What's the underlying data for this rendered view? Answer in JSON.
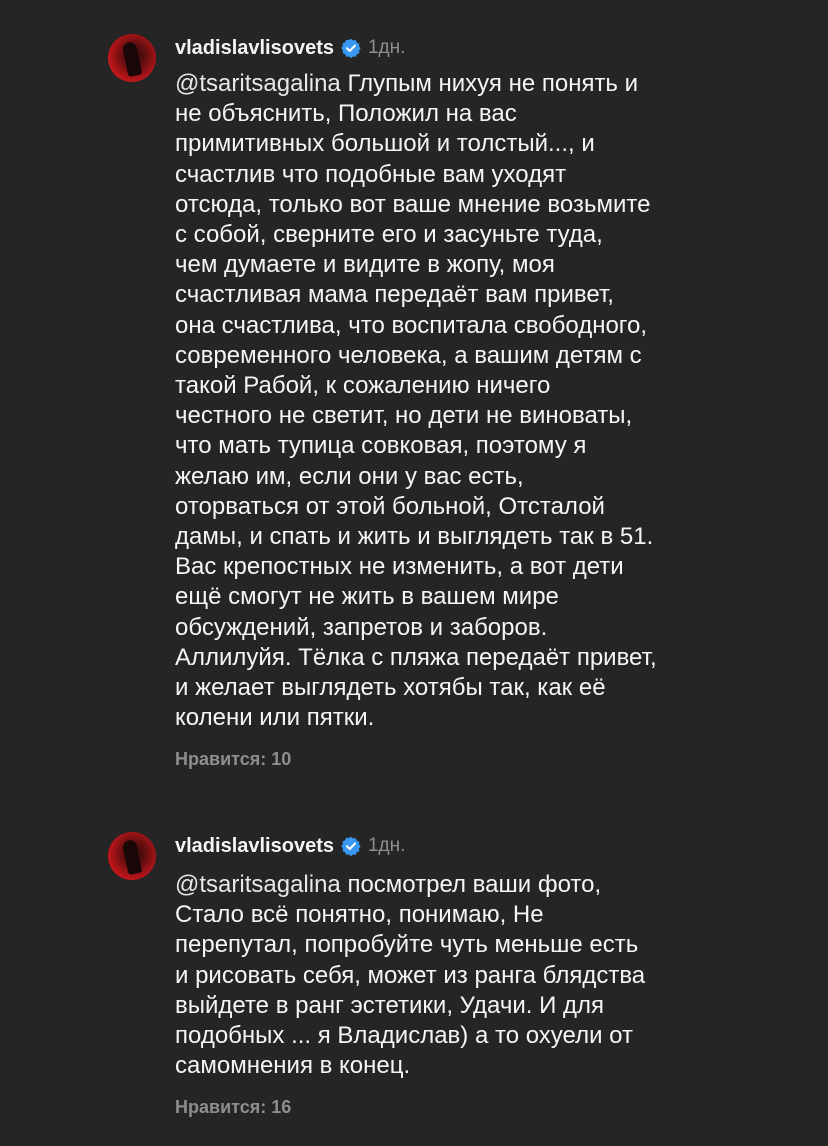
{
  "comments": [
    {
      "username": "vladislavlisovets",
      "time": "1дн.",
      "mention": "@tsaritsagalina",
      "text": "Глупым нихуя не понять и\nне объяснить,  Положил на вас\nпримитивных большой и толстый..., и\nсчастлив что подобные вам уходят\nотсюда, только вот ваше мнение возьмите\nс собой, сверните его и засуньте туда,\nчем думаете и видите в жопу,  моя\nсчастливая мама передаёт вам привет,\nона счастлива, что воспитала свободного,\nсовременного человека, а вашим детям с\nтакой Рабой, к сожалению ничего\nчестного не светит, но дети не виноваты,\nчто мать тупица совковая, поэтому я\nжелаю им, если они у вас есть,\nоторваться от этой больной, Отсталой\nдамы, и спать и жить и выглядеть так в 51.\nВас крепостных не изменить, а вот дети\nещё смогут не жить в вашем мире\nобсуждений, запретов и заборов.\nАллилуйя. Тёлка с пляжа передаёт привет,\nи желает выглядеть хотябы так, как её\nколени или пятки.",
      "likes": "Нравится: 10"
    },
    {
      "username": "vladislavlisovets",
      "time": "1дн.",
      "mention": "@tsaritsagalina",
      "text": "посмотрел ваши фото,\nСтало всё понятно, понимаю,  Не\nперепутал, попробуйте чуть меньше есть\nи рисовать себя, может из ранга блядства\nвыйдете в ранг эстетики, Удачи. И для\nподобных ... я Владислав) а то охуели от\nсамомнения в конец.",
      "likes": "Нравится: 16"
    }
  ],
  "icons": {
    "verified": "verified-badge-icon",
    "verified_color": "#3897f0"
  }
}
